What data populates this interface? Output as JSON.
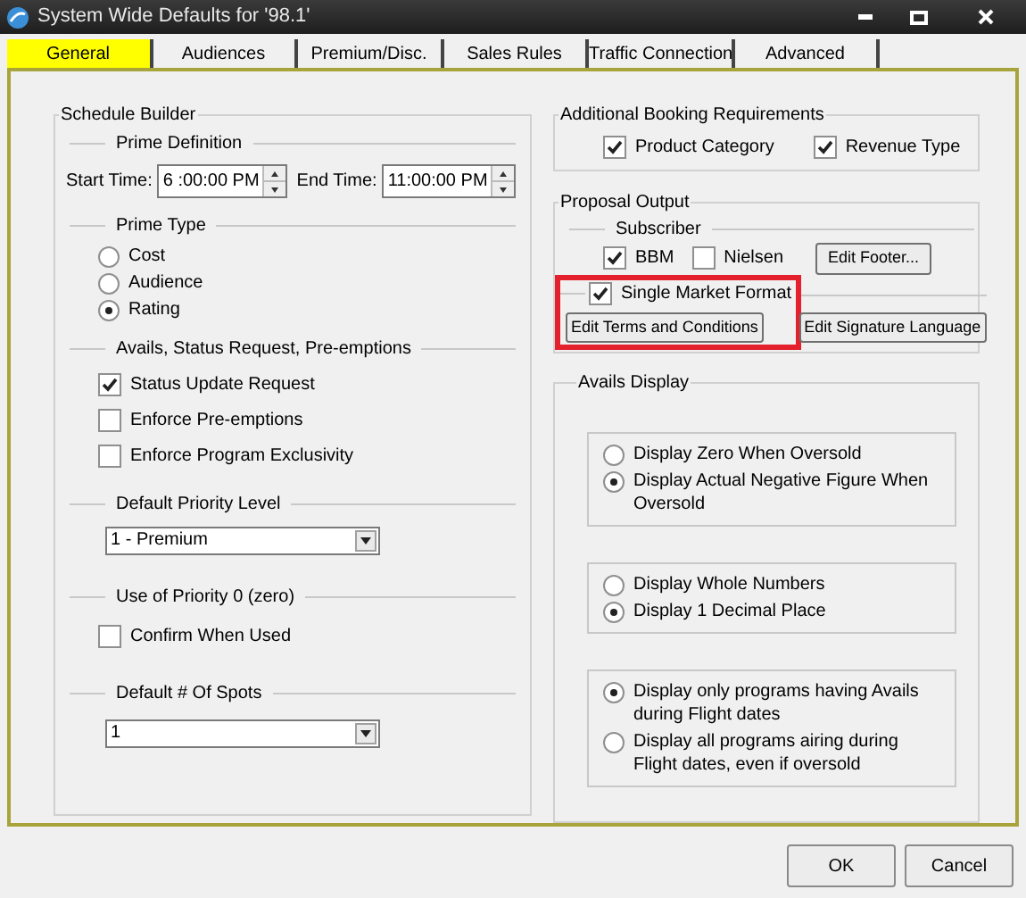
{
  "window": {
    "title": "System Wide Defaults for '98.1'"
  },
  "tabs": [
    {
      "label": "General",
      "selected": true
    },
    {
      "label": "Audiences",
      "selected": false
    },
    {
      "label": "Premium/Disc.",
      "selected": false
    },
    {
      "label": "Sales Rules",
      "selected": false
    },
    {
      "label": "Traffic Connection",
      "selected": false
    },
    {
      "label": "Advanced",
      "selected": false
    }
  ],
  "schedule_builder": {
    "title": "Schedule Builder",
    "prime_definition": {
      "title": "Prime Definition",
      "start_label": "Start Time:",
      "start_value": "6 :00:00 PM",
      "end_label": "End Time:",
      "end_value": "11:00:00 PM"
    },
    "prime_type": {
      "title": "Prime Type",
      "options": [
        {
          "label": "Cost",
          "selected": false
        },
        {
          "label": "Audience",
          "selected": false
        },
        {
          "label": "Rating",
          "selected": true
        }
      ]
    },
    "avails": {
      "title": "Avails, Status Request, Pre-emptions",
      "options": [
        {
          "label": "Status Update Request",
          "checked": true
        },
        {
          "label": "Enforce Pre-emptions",
          "checked": false
        },
        {
          "label": "Enforce Program Exclusivity",
          "checked": false
        }
      ]
    },
    "priority_level": {
      "title": "Default Priority Level",
      "value": "1 - Premium"
    },
    "priority_zero": {
      "title": "Use of Priority 0 (zero)",
      "options": [
        {
          "label": "Confirm When Used",
          "checked": false
        }
      ]
    },
    "spots": {
      "title": "Default # Of Spots",
      "value": "1"
    }
  },
  "booking": {
    "title": "Additional Booking Requirements",
    "options": [
      {
        "label": "Product Category",
        "checked": true
      },
      {
        "label": "Revenue Type",
        "checked": true
      }
    ]
  },
  "proposal": {
    "title": "Proposal Output",
    "subscriber_title": "Subscriber",
    "subscribers": [
      {
        "label": "BBM",
        "checked": true
      },
      {
        "label": "Nielsen",
        "checked": false
      }
    ],
    "footer_button": "Edit Footer...",
    "single_market": {
      "label": "Single Market Format",
      "checked": true
    },
    "terms_button": "Edit Terms and Conditions",
    "signature_button": "Edit Signature Language",
    "highlighted": true
  },
  "avails_display": {
    "title": "Avails Display",
    "groups": [
      {
        "options": [
          {
            "label": "Display Zero When Oversold",
            "selected": false
          },
          {
            "label": "Display Actual Negative Figure When Oversold",
            "selected": true
          }
        ]
      },
      {
        "options": [
          {
            "label": "Display Whole Numbers",
            "selected": false
          },
          {
            "label": "Display 1 Decimal Place",
            "selected": true
          }
        ]
      },
      {
        "options": [
          {
            "label": "Display only programs having Avails during Flight dates",
            "selected": true
          },
          {
            "label": "Display all programs airing during Flight dates, even if oversold",
            "selected": false
          }
        ]
      }
    ]
  },
  "buttons": [
    {
      "label": "OK"
    },
    {
      "label": "Cancel"
    }
  ]
}
